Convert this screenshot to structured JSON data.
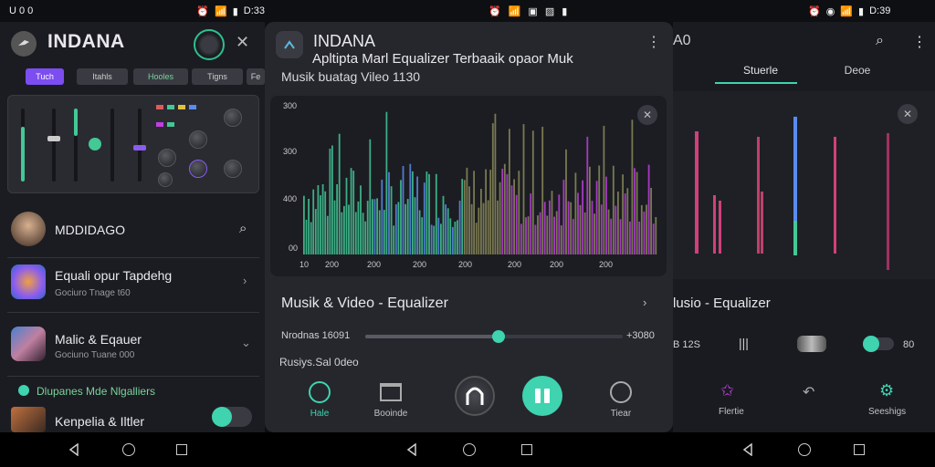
{
  "status_bar": {
    "left_time": "U 0 0",
    "mid_time": "",
    "right_time": "D:33",
    "right_time_alt": "D:39"
  },
  "left_panel": {
    "app_title": "INDANA",
    "chips": [
      "Tuch",
      "Itahls",
      "Hooles",
      "Tigns",
      "Fe"
    ],
    "profile_name": "MDDIDAGO",
    "rows": [
      {
        "title": "Equali opur Tapdehg",
        "sub": "Gociuro Tnage t60"
      },
      {
        "title": "Malic & Eqauer",
        "sub": "Gociuno Tuane 000"
      }
    ],
    "section_label": "Dlupanes Mde Nlgalliers",
    "last_row_title": "Kenpelia & Iltler"
  },
  "middle_panel": {
    "app_title": "INDANA",
    "subtitle": "Apltipta Marl Equalizer Terbaaik opaor Muk",
    "sub2": "Musik buatag Vileo 1130",
    "y_ticks": [
      "300",
      "300",
      "400",
      "00"
    ],
    "x_ticks": [
      "10",
      "200",
      "200",
      "200",
      "200",
      "200",
      "200",
      "200"
    ],
    "section_title": "Musik & Video - Equalizer",
    "slider_left": "Nrodnas 16091",
    "slider_right": "+3080",
    "slider_value": 0.38,
    "caption": "Rusiys.Sal 0deo",
    "controls": [
      {
        "label": "Hale"
      },
      {
        "label": "Booinde"
      },
      {
        "label": ""
      },
      {
        "label": ""
      },
      {
        "label": "Tiear"
      }
    ]
  },
  "right_panel": {
    "app_title": "A0",
    "tabs": [
      "Stuerle",
      "Deoe"
    ],
    "section_title": "lusio - Equalizer",
    "value_left": "B 12S",
    "value_right": "80",
    "bottom_labels": [
      "Flertie",
      "Seeshigs"
    ]
  },
  "colors": {
    "accent_teal": "#3fd3b0",
    "accent_purple": "#8a5cf0",
    "bar_blue": "#5a8cf0",
    "bar_green": "#43c896",
    "bar_magenta": "#c040e0",
    "bar_olive": "#8a8a5a",
    "chip_active": "#7c4df0"
  }
}
